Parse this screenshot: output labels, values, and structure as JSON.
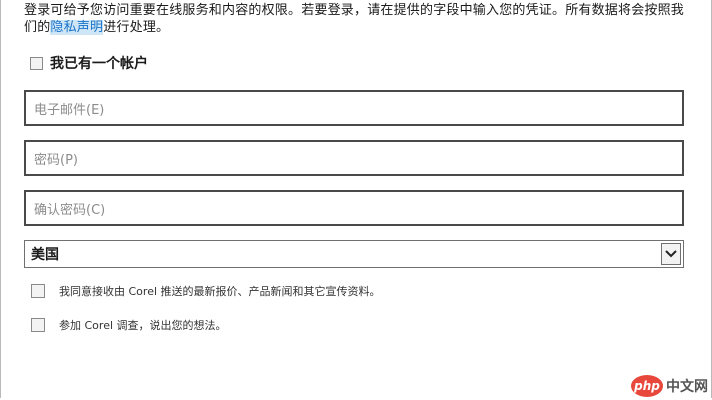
{
  "intro": {
    "text_before_link": "登录可给予您访问重要在线服务和内容的权限。若要登录，请在提供的字段中输入您的凭证。所有数据将会按照我们的",
    "link_text": "隐私声明",
    "text_after_link": "进行处理。"
  },
  "account": {
    "checkbox_label": "我已有一个帐户",
    "checked": false
  },
  "fields": {
    "email_placeholder": "电子邮件(E)",
    "password_placeholder": "密码(P)",
    "confirm_placeholder": "确认密码(C)"
  },
  "country": {
    "selected": "美国",
    "icon": "chevron-down-icon"
  },
  "options": [
    {
      "label": "我同意接收由 Corel 推送的最新报价、产品新闻和其它宣传资料。",
      "checked": false
    },
    {
      "label": "参加 Corel 调查，说出您的想法。",
      "checked": false
    }
  ],
  "watermark": {
    "badge": "php",
    "text": "中文网"
  }
}
